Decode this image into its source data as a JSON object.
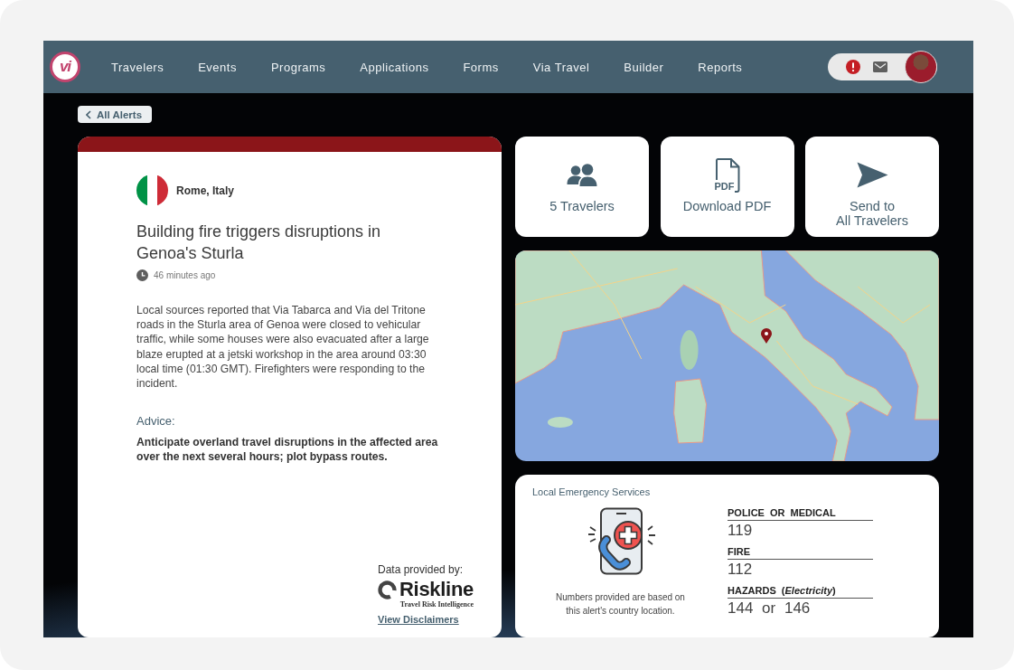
{
  "nav": {
    "logo": "vi",
    "items": [
      "Travelers",
      "Events",
      "Programs",
      "Applications",
      "Forms",
      "Via Travel",
      "Builder",
      "Reports"
    ]
  },
  "back_button": {
    "label": "All Alerts"
  },
  "alert": {
    "location": "Rome, Italy",
    "title": "Building fire triggers disruptions in Genoa's Sturla",
    "time": "46 minutes ago",
    "description": "Local sources reported that Via Tabarca and Via del Tritone roads in the Sturla area of Genoa were closed to vehicular traffic, while some houses were also evacuated after a large blaze erupted at a jetski workshop in the area around 03:30 local time (01:30 GMT). Firefighters were responding to the incident.",
    "advice_heading": "Advice:",
    "advice": "Anticipate overland travel disruptions in the affected area over the next several hours; plot bypass routes.",
    "source": {
      "label": "Data provided by:",
      "brand": "Riskline",
      "tagline": "Travel Risk Intelligence",
      "link": "View Disclaimers"
    }
  },
  "actions": [
    {
      "kind": "travelers",
      "label": "5 Travelers"
    },
    {
      "kind": "pdf",
      "icon_text": "PDF",
      "label": "Download PDF"
    },
    {
      "kind": "send",
      "label": "Send to\nAll Travelers"
    }
  ],
  "emergency": {
    "title": "Local Emergency Services",
    "note": "Numbers provided are based on this alert's country location.",
    "services": [
      {
        "label": "POLICE OR MEDICAL",
        "number": "119"
      },
      {
        "label": "FIRE",
        "number": "112"
      },
      {
        "label": "HAZARDS (*Electricity*)",
        "number": "144 or 146"
      }
    ]
  }
}
